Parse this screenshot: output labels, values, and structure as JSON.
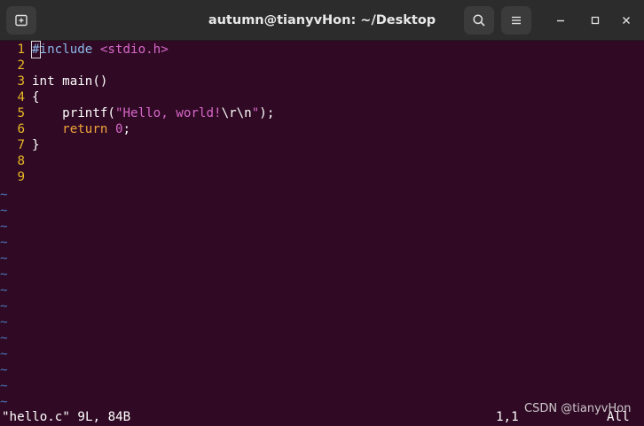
{
  "window": {
    "title": "autumn@tianyvHon: ~/Desktop"
  },
  "icons": {
    "new_tab": "new-tab-icon",
    "search": "search-icon",
    "menu": "hamburger-menu-icon",
    "minimize": "minimize-icon",
    "maximize": "maximize-icon",
    "close": "close-icon"
  },
  "colors": {
    "background": "#300a24",
    "line_number": "#e9b825",
    "tilde": "#4a77b9",
    "preprocessor": "#8bb7e8",
    "string": "#d767c9",
    "keyword_return": "#f0a33b"
  },
  "editor": {
    "lines": [
      {
        "num": "1",
        "cursor_char": "#",
        "preproc": "include",
        "space": " ",
        "header": "<stdio.h>"
      },
      {
        "num": "2"
      },
      {
        "num": "3",
        "text": "int main()"
      },
      {
        "num": "4",
        "text": "{"
      },
      {
        "num": "5",
        "indent": "    ",
        "fn": "printf(",
        "str_a": "\"Hello, world!",
        "esc": "\\r\\n",
        "str_b": "\"",
        "tail": ");"
      },
      {
        "num": "6",
        "indent": "    ",
        "kw": "return",
        "sp": " ",
        "value": "0",
        "semi": ";"
      },
      {
        "num": "7",
        "text": "}"
      },
      {
        "num": "8"
      },
      {
        "num": "9"
      }
    ],
    "tilde": "~"
  },
  "status": {
    "file": "\"hello.c\" 9L, 84B",
    "position": "1,1",
    "scroll": "All"
  },
  "watermark": "CSDN @tianyvHon"
}
